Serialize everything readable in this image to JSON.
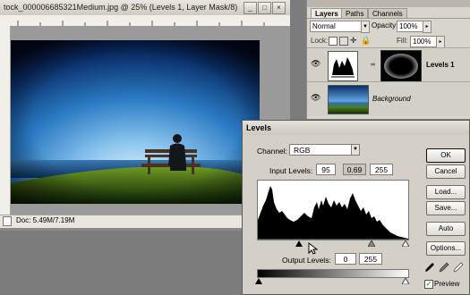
{
  "document": {
    "title": "tock_000006685321Medium.jpg @ 25% (Levels 1, Layer Mask/8)",
    "status_doc": "Doc: 5.49M/7.19M",
    "minimize": "_",
    "restore": "□",
    "close": "×"
  },
  "layers_panel": {
    "tabs": [
      "Layers",
      "Paths",
      "Channels"
    ],
    "blend_mode": "Normal",
    "opacity_label": "Opacity:",
    "opacity_value": "100%",
    "lock_label": "Lock:",
    "fill_label": "Fill:",
    "fill_value": "100%",
    "layers": [
      {
        "name": "Levels 1"
      },
      {
        "name": "Background"
      }
    ]
  },
  "levels_dialog": {
    "title": "Levels",
    "channel_label": "Channel:",
    "channel_value": "RGB",
    "input_levels_label": "Input Levels:",
    "input_levels": [
      "95",
      "0.69",
      "255"
    ],
    "output_levels_label": "Output Levels:",
    "output_levels": [
      "0",
      "255"
    ],
    "buttons": {
      "ok": "OK",
      "cancel": "Cancel",
      "load": "Load...",
      "save": "Save...",
      "auto": "Auto",
      "options": "Options..."
    },
    "preview_label": "Preview",
    "preview_checked": true
  }
}
